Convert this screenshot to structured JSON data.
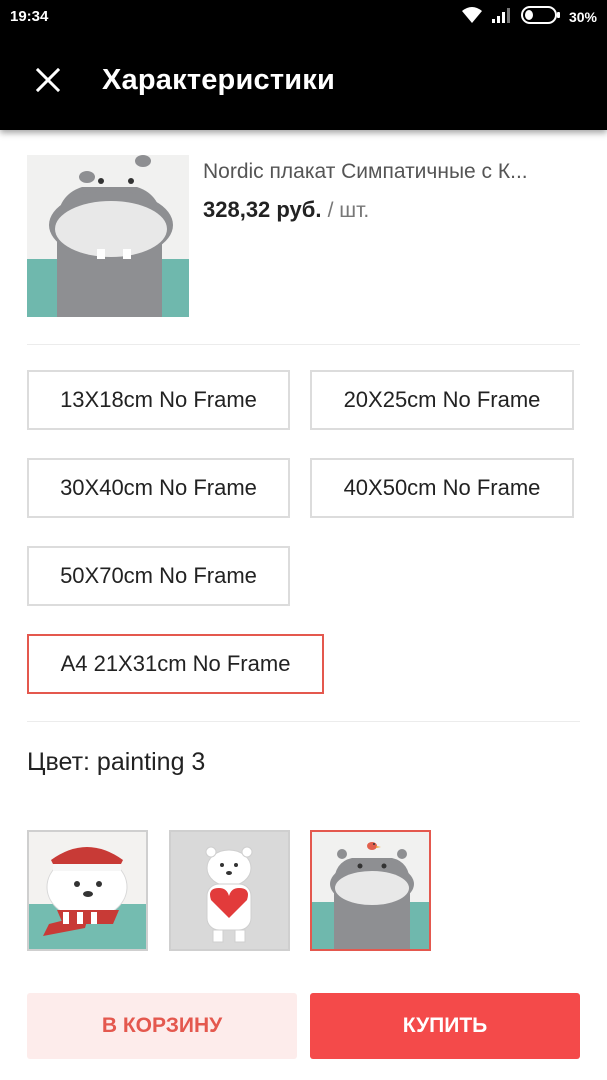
{
  "status_bar": {
    "time": "19:34",
    "battery_percent": "30%",
    "battery_level": 0.3,
    "icons": [
      "wifi-icon",
      "signal-icon",
      "battery-icon"
    ]
  },
  "app_bar": {
    "title": "Характеристики",
    "close_icon": "close-icon"
  },
  "product": {
    "name": "Nordic плакат Симпатичные с К...",
    "price": "328,32 руб.",
    "unit": "/ шт."
  },
  "sizes": {
    "selected_index": 5,
    "options": [
      {
        "label": "13X18cm No Frame"
      },
      {
        "label": "20X25cm No Frame"
      },
      {
        "label": "30X40cm No Frame"
      },
      {
        "label": "40X50cm No Frame"
      },
      {
        "label": "50X70cm No Frame"
      },
      {
        "label": "A4 21X31cm No Frame"
      }
    ]
  },
  "color": {
    "label": "Цвет: painting 3",
    "selected_index": 2,
    "options": [
      "polar-bear-scarf-image",
      "polar-bear-heart-image",
      "hippo-bird-image"
    ]
  },
  "actions": {
    "add_to_cart_label": "В КОРЗИНУ",
    "buy_label": "КУПИТЬ"
  },
  "colors": {
    "accent": "#f44a4a",
    "accent_light": "#fdeceb",
    "selected_border": "#e4584e",
    "bar_background": "#000000"
  }
}
